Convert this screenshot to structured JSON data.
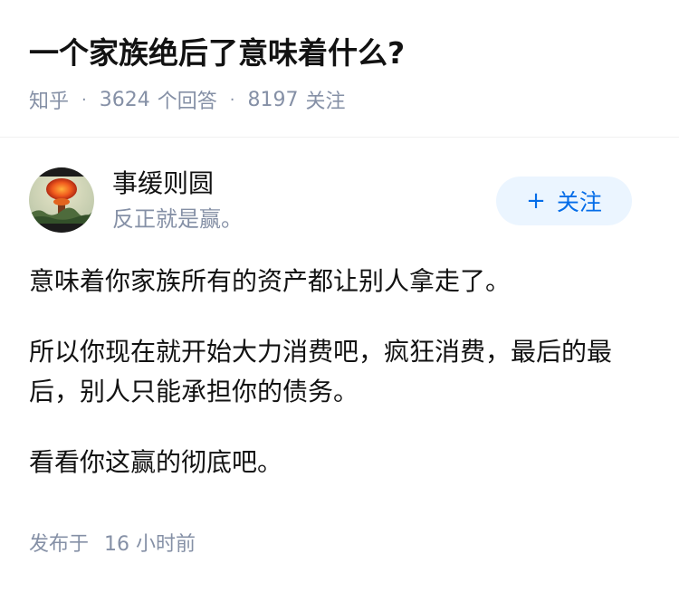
{
  "question": {
    "title": "一个家族绝后了意味着什么?",
    "source": "知乎",
    "answer_count": "3624",
    "answer_label": "个回答",
    "follower_count": "8197",
    "follower_label": "关注"
  },
  "author": {
    "name": "事缓则圆",
    "bio": "反正就是赢。",
    "follow_label": "关注"
  },
  "answer": {
    "paragraphs": [
      "意味着你家族所有的资产都让别人拿走了。",
      "所以你现在就开始大力消费吧，疯狂消费，最后的最后，别人只能承担你的债务。",
      "看看你这赢的彻底吧。"
    ],
    "time_prefix": "发布于",
    "time_value": "16 小时前"
  },
  "colors": {
    "meta_gray": "#8590a6",
    "accent_blue": "#056de8",
    "follow_bg": "#ebf5ff"
  }
}
